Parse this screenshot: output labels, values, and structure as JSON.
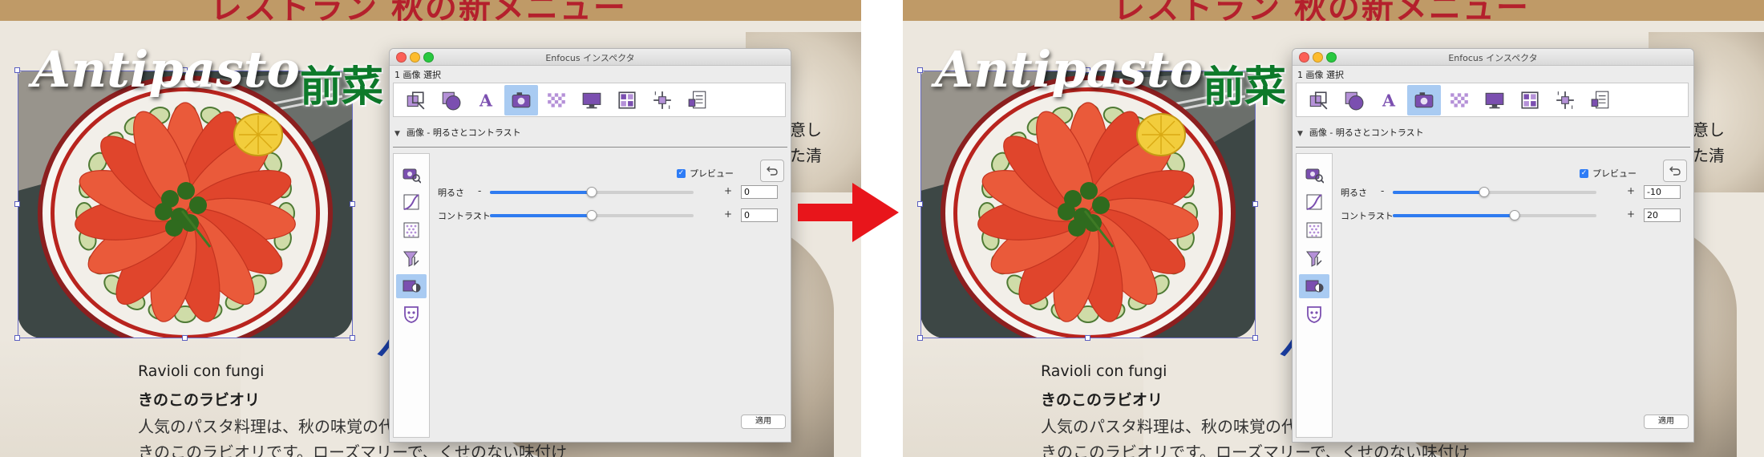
{
  "document": {
    "banner_title": "レストラン 秋の新メニュー",
    "title_latin": "Antipasto",
    "title_jp": "前菜",
    "right_text": [
      "意し",
      "た清"
    ],
    "side_heading": "パ",
    "body_lines": [
      "Ravioli con fungi",
      "きのこのラビオリ",
      "人気のパスタ料理は、秋の味覚の代",
      "きのこのラビオリです。ローズマリーで、くせのない味付け"
    ]
  },
  "inspector": {
    "window_title": "Enfocus インスペクタ",
    "subtitle": "1 画像 選択",
    "toolbar_icons": [
      "object-icon",
      "shape-icon",
      "text-icon",
      "image-icon",
      "transparency-icon",
      "display-icon",
      "layers-icon",
      "position-icon",
      "document-icon"
    ],
    "active_tool": "image-icon",
    "section_title": "画像 - 明るさとコントラスト",
    "side_icons": [
      "image-inspect-icon",
      "curves-icon",
      "dither-icon",
      "filter-icon",
      "brightness-contrast-icon",
      "mask-icon"
    ],
    "active_side_icon": "brightness-contrast-icon",
    "preview_label": "プレビュー",
    "preview_checked": true,
    "brightness_label": "明るさ",
    "contrast_label": "コントラスト",
    "minus": "-",
    "plus": "+",
    "apply_label": "適用"
  },
  "states": {
    "before": {
      "brightness": "0",
      "contrast": "0",
      "brightness_level": 0.5,
      "contrast_level": 0.5
    },
    "after": {
      "brightness": "-10",
      "contrast": "20",
      "brightness_level": 0.45,
      "contrast_level": 0.6
    }
  },
  "colors": {
    "arrow": "#e8151b",
    "accent_blue": "#2f7bf0",
    "selection_blue": "#a9cbf2",
    "banner_gold": "#bf9a67",
    "banner_text": "#b4202c",
    "title_green": "#0d7a2a"
  }
}
